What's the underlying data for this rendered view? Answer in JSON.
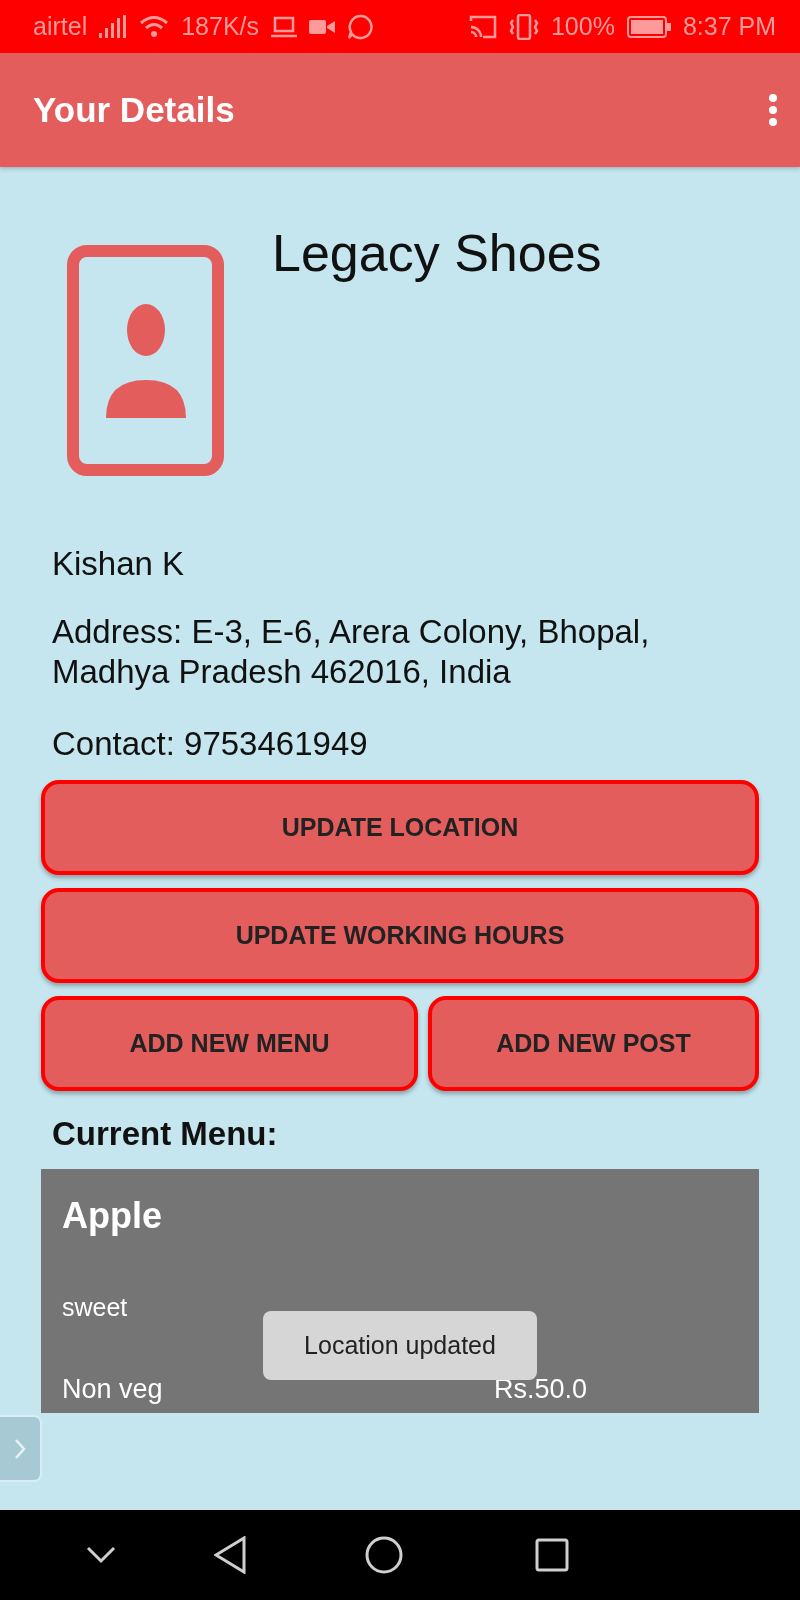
{
  "status_bar": {
    "carrier": "airtel",
    "speed": "187K/s",
    "battery": "100%",
    "time": "8:37 PM"
  },
  "app_bar": {
    "title": "Your Details"
  },
  "profile": {
    "shop_name": "Legacy Shoes",
    "owner": "Kishan K",
    "address": "Address: E-3, E-6, Arera Colony, Bhopal, Madhya Pradesh 462016, India",
    "contact": "Contact: 9753461949"
  },
  "buttons": [
    {
      "label": "UPDATE LOCATION",
      "kind": "wide"
    },
    {
      "label": "UPDATE WORKING HOURS",
      "kind": "wide"
    },
    {
      "label": "ADD NEW MENU",
      "kind": "half"
    },
    {
      "label": "ADD NEW POST",
      "kind": "half"
    }
  ],
  "menu": {
    "heading": "Current Menu:",
    "items": [
      {
        "name": "Apple",
        "description": "sweet",
        "category": "Non veg",
        "price": "Rs.50.0"
      }
    ]
  },
  "toast": {
    "message": "Location updated"
  }
}
